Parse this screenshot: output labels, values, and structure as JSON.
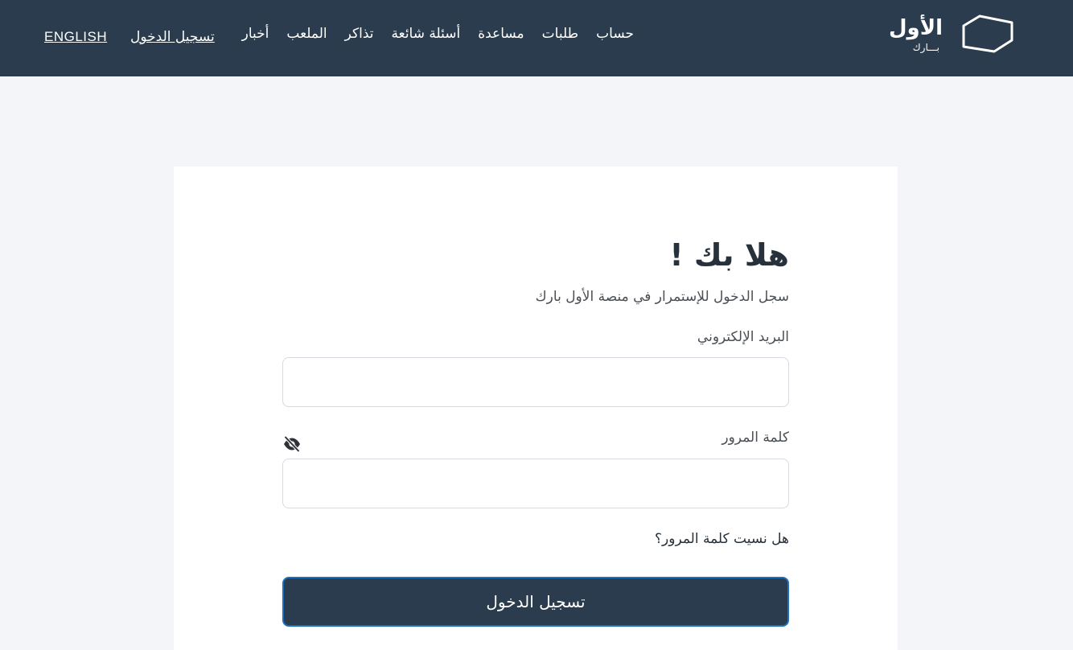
{
  "brand": {
    "logo_text": "الأول",
    "logo_sub": "بـــارك"
  },
  "nav": {
    "items": [
      {
        "label": "أخبار"
      },
      {
        "label": "الملعب"
      },
      {
        "label": "تذاكر"
      },
      {
        "label": "أسئلة شائعة"
      },
      {
        "label": "مساعدة"
      },
      {
        "label": "طلبات"
      },
      {
        "label": "حساب"
      }
    ],
    "login_label": "تسجيل الدخول",
    "language_label": "ENGLISH"
  },
  "login": {
    "title": "هلا بك !",
    "subtitle": "سجل الدخول للإستمرار في منصة الأول بارك",
    "email_label": "البريد الإلكتروني",
    "email_value": "",
    "password_label": "كلمة المرور",
    "password_value": "",
    "forgot_label": "هل نسيت كلمة المرور؟",
    "submit_label": "تسجيل الدخول"
  },
  "colors": {
    "header_bg": "#2a3c4d",
    "page_bg": "#f3f5f9",
    "button_bg": "#2a3c4d",
    "button_border": "#1f6fc0"
  },
  "icons": {
    "logo": "shield-outline-logo",
    "password_toggle": "eye-slash-icon"
  }
}
